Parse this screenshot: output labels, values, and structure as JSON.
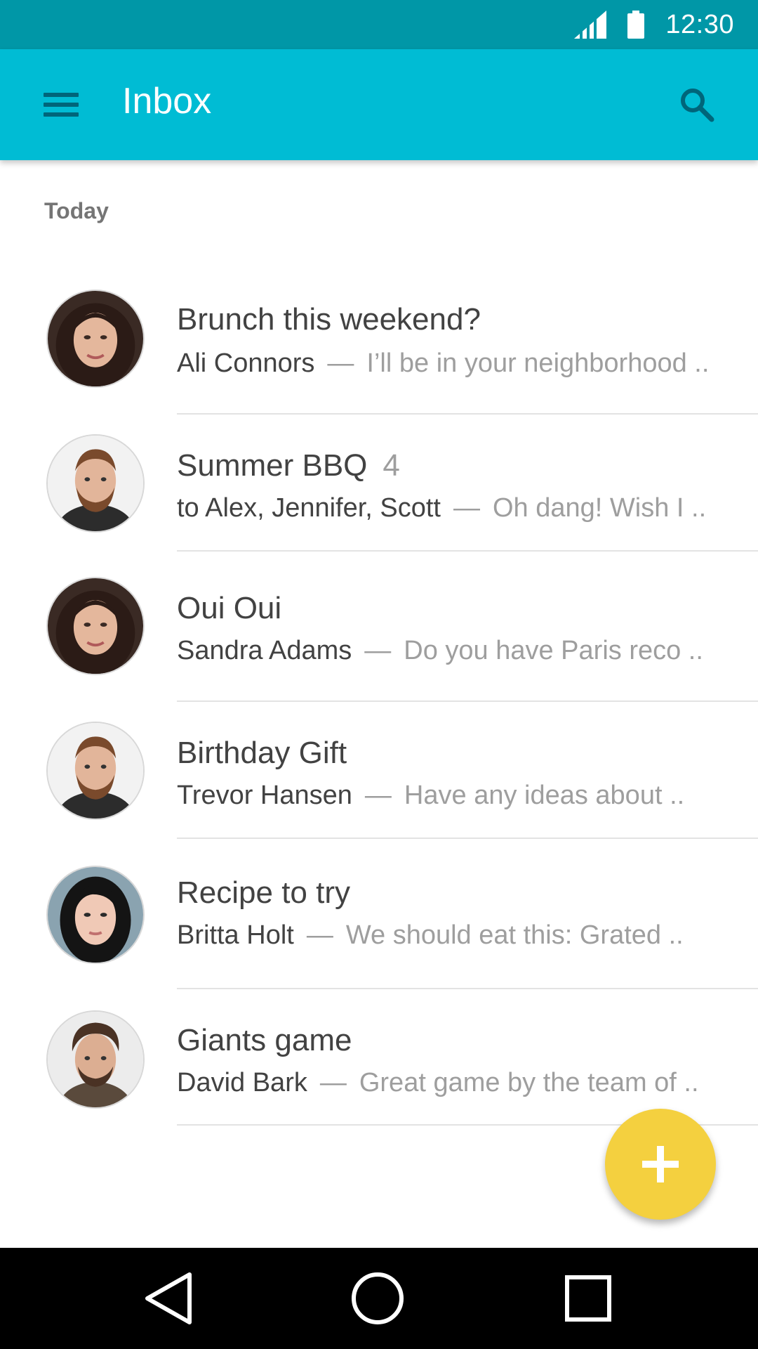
{
  "status_bar": {
    "time": "12:30",
    "signal_icon": "signal-icon",
    "battery_icon": "battery-icon"
  },
  "app_bar": {
    "title": "Inbox",
    "menu_icon": "menu-icon",
    "search_icon": "search-icon"
  },
  "section": {
    "label": "Today"
  },
  "mails": [
    {
      "subject": "Brunch this weekend?",
      "count": "",
      "sender": "Ali Connors",
      "snippet": "I’ll be in your neighborhood ..",
      "avatar": "avatar-woman-curly"
    },
    {
      "subject": "Summer BBQ",
      "count": "4",
      "sender": "to Alex, Jennifer, Scott",
      "snippet": "Oh dang! Wish I ..",
      "avatar": "avatar-man-beard"
    },
    {
      "subject": "Oui Oui",
      "count": "",
      "sender": "Sandra Adams",
      "snippet": "Do you have Paris reco ..",
      "avatar": "avatar-woman-curly"
    },
    {
      "subject": "Birthday Gift",
      "count": "",
      "sender": "Trevor Hansen",
      "snippet": "Have any ideas about ..",
      "avatar": "avatar-man-beard"
    },
    {
      "subject": "Recipe to try",
      "count": "",
      "sender": "Britta Holt",
      "snippet": "We should eat this: Grated ..",
      "avatar": "avatar-woman-straight"
    },
    {
      "subject": "Giants game",
      "count": "",
      "sender": "David Bark",
      "snippet": "Great game by the team of ..",
      "avatar": "avatar-man-curly"
    }
  ],
  "fab": {
    "icon": "plus-icon"
  },
  "colors": {
    "status_bar": "#0097a7",
    "app_bar": "#00bcd4",
    "fab": "#f4d03f",
    "nav_bar": "#000000"
  },
  "nav": {
    "back_icon": "back-icon",
    "home_icon": "home-icon",
    "recents_icon": "recents-icon"
  },
  "dash": "—"
}
